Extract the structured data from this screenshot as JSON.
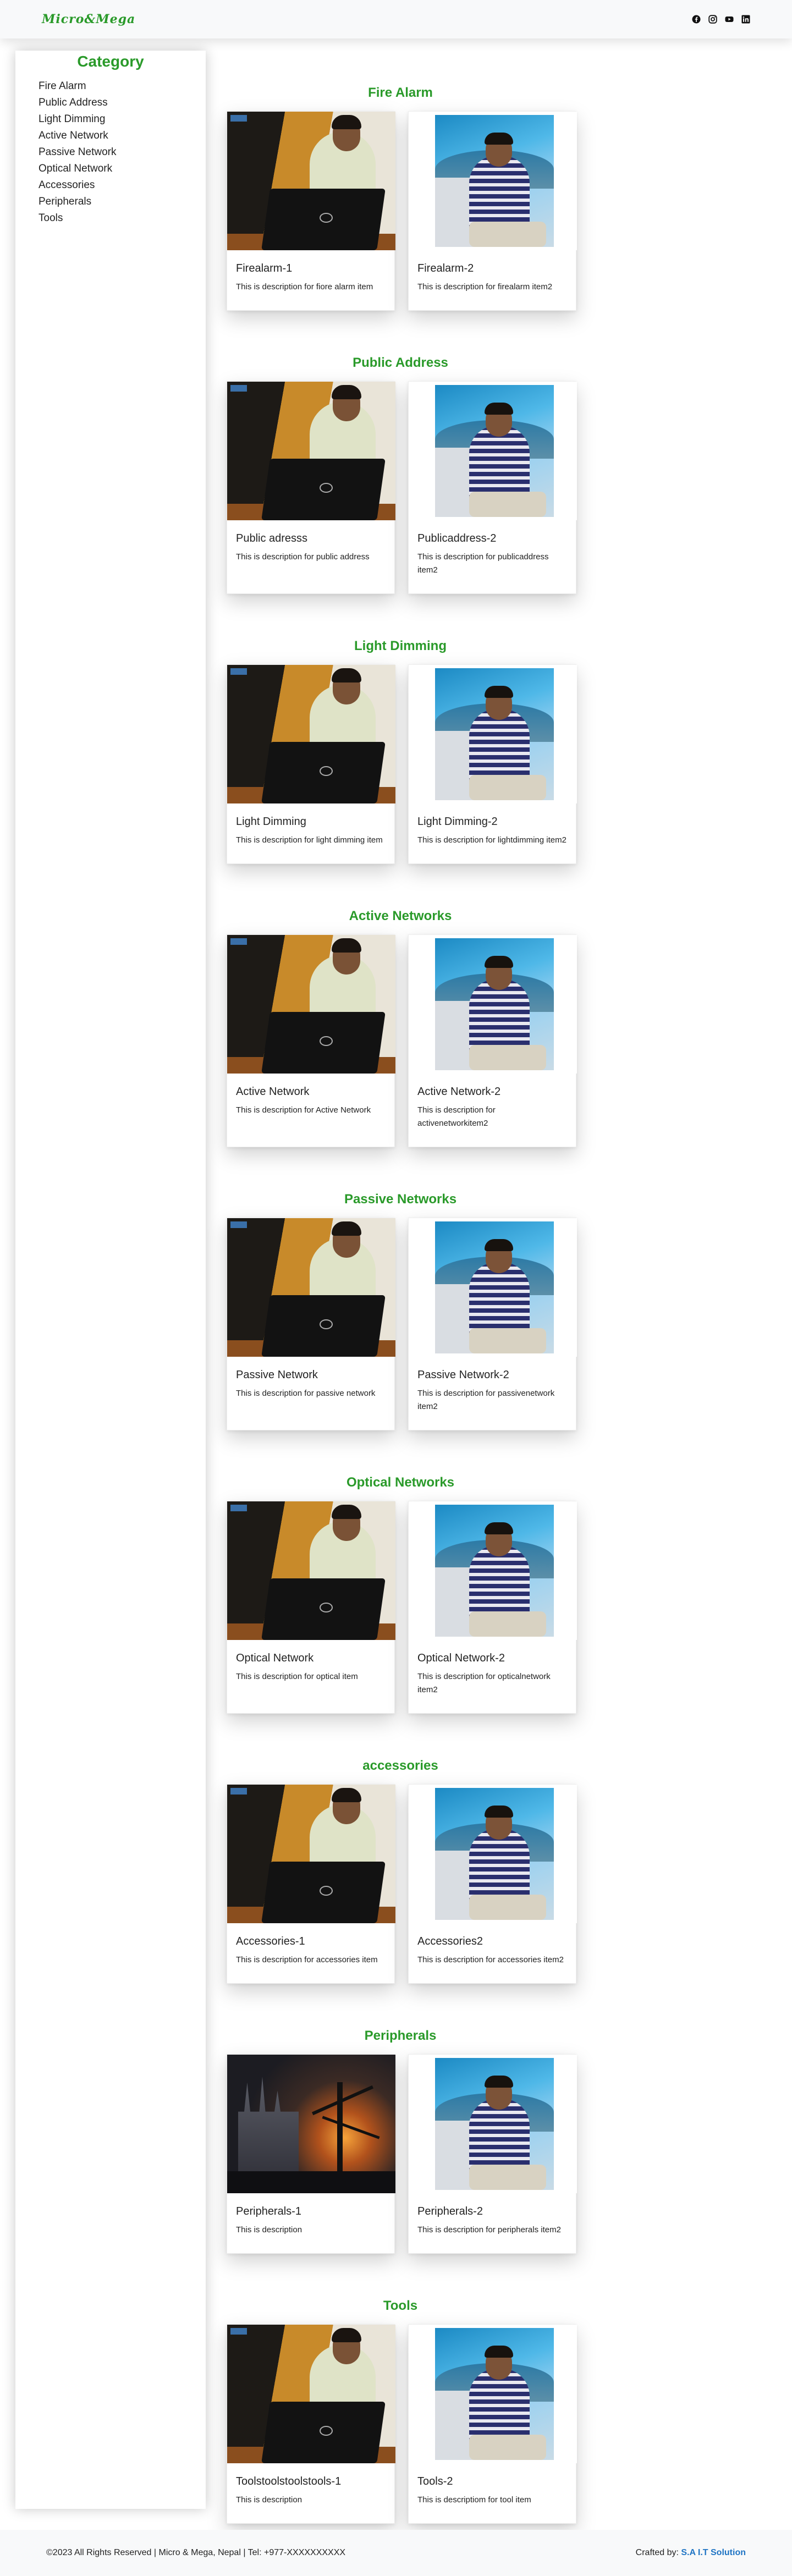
{
  "header": {
    "logo": "Micro&Mega",
    "social_icons": [
      "facebook-icon",
      "instagram-icon",
      "youtube-icon",
      "linkedin-icon"
    ]
  },
  "sidebar": {
    "title": "Category",
    "items": [
      {
        "label": "Fire Alarm"
      },
      {
        "label": "Public Address"
      },
      {
        "label": "Light Dimming"
      },
      {
        "label": "Active Network"
      },
      {
        "label": "Passive Network"
      },
      {
        "label": "Optical Network"
      },
      {
        "label": "Accessories"
      },
      {
        "label": "Peripherals"
      },
      {
        "label": "Tools"
      }
    ]
  },
  "sections": [
    {
      "title": "Fire Alarm",
      "cards": [
        {
          "title": "Firealarm-1",
          "desc": "This is description for fiore alarm item"
        },
        {
          "title": "Firealarm-2",
          "desc": "This is description for firealarm item2"
        }
      ]
    },
    {
      "title": "Public Address",
      "cards": [
        {
          "title": "Public adresss",
          "desc": "This is description for public address"
        },
        {
          "title": "Publicaddress-2",
          "desc": "This is description for publicaddress item2"
        }
      ]
    },
    {
      "title": "Light Dimming",
      "cards": [
        {
          "title": "Light Dimming",
          "desc": "This is description for light dimming item"
        },
        {
          "title": "Light Dimming-2",
          "desc": "This is description for lightdimming item2"
        }
      ]
    },
    {
      "title": "Active Networks",
      "cards": [
        {
          "title": "Active Network",
          "desc": "This is description for Active Network"
        },
        {
          "title": "Active Network-2",
          "desc": "This is description for activenetworkitem2"
        }
      ]
    },
    {
      "title": "Passive Networks",
      "cards": [
        {
          "title": "Passive Network",
          "desc": "This is description for passive network"
        },
        {
          "title": "Passive Network-2",
          "desc": "This is description for passivenetwork item2"
        }
      ]
    },
    {
      "title": "Optical Networks",
      "cards": [
        {
          "title": "Optical Network",
          "desc": "This is description for optical item"
        },
        {
          "title": "Optical Network-2",
          "desc": "This is description for opticalnetwork item2"
        }
      ]
    },
    {
      "title": "accessories",
      "cards": [
        {
          "title": "Accessories-1",
          "desc": "This is description for accessories item"
        },
        {
          "title": "Accessories2",
          "desc": "This is description for accessories item2"
        }
      ]
    },
    {
      "title": "Peripherals",
      "cards": [
        {
          "title": "Peripherals-1",
          "desc": "This is description"
        },
        {
          "title": "Peripherals-2",
          "desc": "This is description for peripherals item2"
        }
      ]
    },
    {
      "title": "Tools",
      "cards": [
        {
          "title": "Toolstoolstoolstools-1",
          "desc": "This is description"
        },
        {
          "title": "Tools-2",
          "desc": "This is descriptiom for tool item"
        }
      ]
    }
  ],
  "footer": {
    "copyright": "©2023 All Rights Reserved | Micro & Mega, Nepal | Tel: +977-XXXXXXXXXX",
    "crafted_prefix": "Crafted by: ",
    "crafted_link": "S.A I.T Solution"
  },
  "colors": {
    "accent": "#2a9a2a",
    "link": "#1f74c4"
  }
}
